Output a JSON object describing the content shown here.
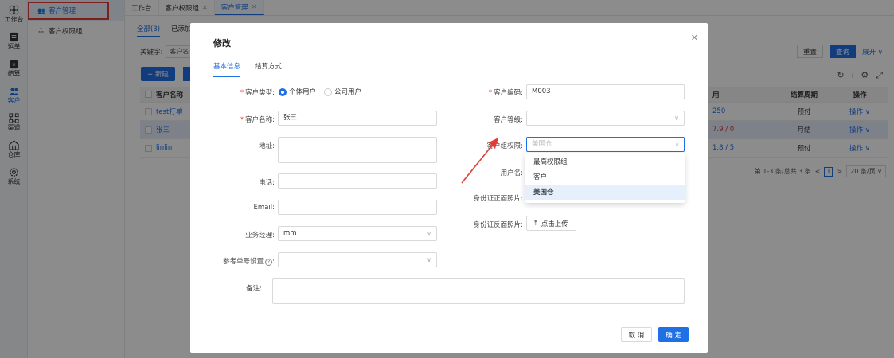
{
  "rail": [
    {
      "label": "工作台",
      "icon": "grid-icon"
    },
    {
      "label": "运单",
      "icon": "document-icon"
    },
    {
      "label": "结算",
      "icon": "wallet-icon"
    },
    {
      "label": "客户",
      "icon": "users-icon"
    },
    {
      "label": "渠道",
      "icon": "channel-icon"
    },
    {
      "label": "仓库",
      "icon": "warehouse-icon"
    },
    {
      "label": "系统",
      "icon": "gear-icon"
    }
  ],
  "subnav": [
    {
      "label": "客户管理",
      "icon": "users-icon"
    },
    {
      "label": "客户权限组",
      "icon": "group-icon"
    }
  ],
  "top_tabs": [
    {
      "label": "工作台",
      "closable": false
    },
    {
      "label": "客户权限组",
      "closable": true
    },
    {
      "label": "客户管理",
      "closable": true
    }
  ],
  "content": {
    "filter_tab_all": "全部(3)",
    "filter_tab_added": "已添加",
    "keyword_label": "关键字:",
    "keyword_value": "客户名",
    "new_button": "+ 新建",
    "reset_button": "重置",
    "query_button": "查询",
    "expand_link": "展开 ∨",
    "table": {
      "headers": {
        "name": "客户名称",
        "balance": "用",
        "period": "结算周期",
        "op": "操作"
      },
      "rows": [
        {
          "name": "test打单",
          "balance": "250",
          "period": "预付",
          "op": "操作 ∨"
        },
        {
          "name": "张三",
          "balance": "7.9 / 0",
          "period": "月结",
          "op": "操作 ∨"
        },
        {
          "name": "linlin",
          "balance": "1.8 / 5",
          "period": "预付",
          "op": "操作 ∨"
        }
      ]
    },
    "pager": {
      "summary": "第 1-3 条/总共 3 条",
      "prev": "<",
      "page": "1",
      "next": ">",
      "size": "20 条/页 ∨"
    }
  },
  "modal": {
    "title": "修改",
    "tabs": [
      "基本信息",
      "结算方式"
    ],
    "fields": {
      "customer_type_label": "客户类型:",
      "customer_type_opt1": "个体用户",
      "customer_type_opt2": "公司用户",
      "customer_code_label": "客户编码:",
      "customer_code_value": "M003",
      "customer_name_label": "客户名称:",
      "customer_name_value": "张三",
      "customer_level_label": "客户等级:",
      "address_label": "地址:",
      "group_label": "客户组权限:",
      "group_placeholder": "美国仓",
      "username_label": "用户名:",
      "phone_label": "电话:",
      "id_front_label": "身份证正面照片:",
      "email_label": "Email:",
      "id_back_label": "身份证反面照片:",
      "upload_label": "点击上传",
      "manager_label": "业务经理:",
      "manager_value": "mm",
      "ref_label": "参考单号设置",
      "remark_label": "备注:"
    },
    "dropdown": [
      "最高权限组",
      "客户",
      "美国仓"
    ],
    "cancel": "取 消",
    "ok": "确 定"
  },
  "colors": {
    "accent": "#1f6fe5",
    "required": "#e53935",
    "annotation": "#e53935"
  }
}
